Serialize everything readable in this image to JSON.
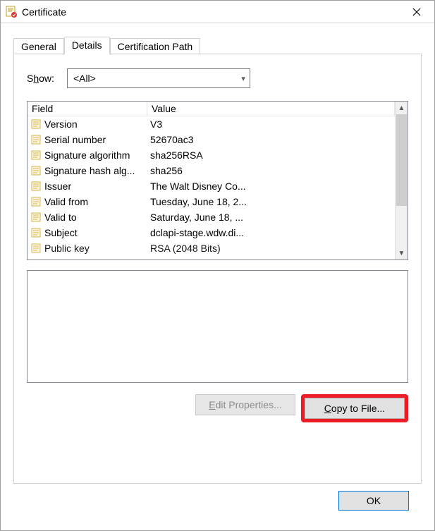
{
  "window": {
    "title": "Certificate"
  },
  "tabs": {
    "general": "General",
    "details": "Details",
    "cert_path": "Certification Path",
    "active": "details"
  },
  "show": {
    "label_pre": "S",
    "label_ul": "h",
    "label_post": "ow:",
    "selected": "<All>"
  },
  "columns": {
    "field": "Field",
    "value": "Value"
  },
  "rows": [
    {
      "field": "Version",
      "value": "V3"
    },
    {
      "field": "Serial number",
      "value": "52670ac3"
    },
    {
      "field": "Signature algorithm",
      "value": "sha256RSA"
    },
    {
      "field": "Signature hash alg...",
      "value": "sha256"
    },
    {
      "field": "Issuer",
      "value": "The Walt Disney Co..."
    },
    {
      "field": "Valid from",
      "value": "Tuesday, June 18, 2..."
    },
    {
      "field": "Valid to",
      "value": "Saturday, June 18, ..."
    },
    {
      "field": "Subject",
      "value": "dclapi-stage.wdw.di..."
    },
    {
      "field": "Public key",
      "value": "RSA (2048 Bits)"
    }
  ],
  "buttons": {
    "edit_ul": "E",
    "edit_rest": "dit Properties...",
    "copy_ul": "C",
    "copy_rest": "opy to File...",
    "ok": "OK"
  }
}
